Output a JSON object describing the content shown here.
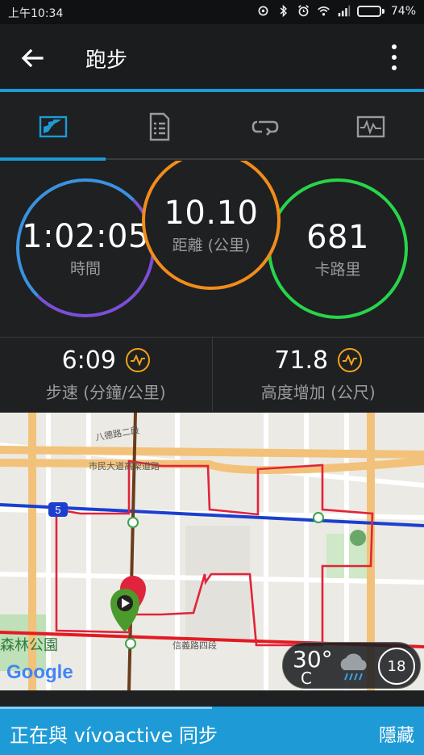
{
  "status_bar": {
    "time": "上午10:34",
    "battery": "74%",
    "battery_level": 0.74
  },
  "app_bar": {
    "title": "跑步",
    "back_icon": "arrow-left-icon",
    "menu_icon": "more-vert-icon"
  },
  "tabs": [
    {
      "name": "overview",
      "icon": "stats-chart-icon",
      "active": true
    },
    {
      "name": "details",
      "icon": "document-list-icon",
      "active": false
    },
    {
      "name": "laps",
      "icon": "loop-icon",
      "active": false
    },
    {
      "name": "graphs",
      "icon": "waveform-icon",
      "active": false
    }
  ],
  "stats": {
    "time": {
      "value": "1:02:05",
      "label": "時間"
    },
    "distance": {
      "value": "10.10",
      "label": "距離 (公里)"
    },
    "calories": {
      "value": "681",
      "label": "卡路里"
    }
  },
  "metrics": {
    "pace": {
      "value": "6:09",
      "label": "步速 (分鐘/公里)"
    },
    "elevation": {
      "value": "71.8",
      "label": "高度增加 (公尺)"
    }
  },
  "map": {
    "roads": {
      "road1": "八德路二段",
      "road2": "市民大道高架道路",
      "road3": "信義路四段",
      "route_no": "5"
    },
    "park": "森林公園",
    "google": "Google",
    "weather": {
      "temp": "30°",
      "unit": "C",
      "wind": "18"
    }
  },
  "sync_bar": {
    "message": "正在與 vívoactive 同步",
    "hide_label": "隱藏",
    "progress": 0.5
  },
  "colors": {
    "accent": "#1e9bd6",
    "time_ring": "#3a92e0",
    "distance_ring": "#f28c1b",
    "calories_ring": "#27d54a",
    "route": "#e0243b"
  }
}
